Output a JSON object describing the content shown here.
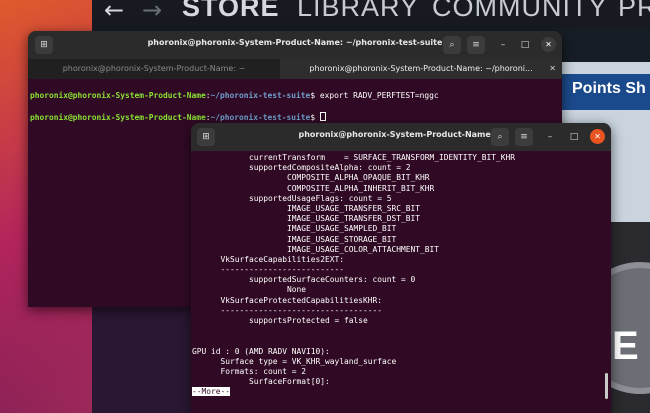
{
  "steam": {
    "nav": [
      "STORE",
      "LIBRARY",
      "COMMUNITY",
      "PR"
    ],
    "points_label": "Points Sh",
    "art_letter": "E"
  },
  "terminal1": {
    "title": "phoronix@phoronix-System-Product-Name: ~/phoronix-test-suite",
    "tabs": [
      {
        "label": "phoronix@phoronix-System-Product-Name: ~"
      },
      {
        "label": "phoronix@phoronix-System-Product-Name: ~/phoroni..."
      }
    ],
    "lines": [
      {
        "user": "phoronix@phoronix-System-Product-Name",
        "path": "~/phoronix-test-suite",
        "cmd": "export RADV_PERFTEST=nggc"
      },
      {
        "user": "phoronix@phoronix-System-Product-Name",
        "path": "~/phoronix-test-suite",
        "cmd": ""
      }
    ]
  },
  "terminal2": {
    "title": "phoronix@phoronix-System-Product-Name: ~",
    "lines": [
      "            currentTransform    = SURFACE_TRANSFORM_IDENTITY_BIT_KHR",
      "            supportedCompositeAlpha: count = 2",
      "                    COMPOSITE_ALPHA_OPAQUE_BIT_KHR",
      "                    COMPOSITE_ALPHA_INHERIT_BIT_KHR",
      "            supportedUsageFlags: count = 5",
      "                    IMAGE_USAGE_TRANSFER_SRC_BIT",
      "                    IMAGE_USAGE_TRANSFER_DST_BIT",
      "                    IMAGE_USAGE_SAMPLED_BIT",
      "                    IMAGE_USAGE_STORAGE_BIT",
      "                    IMAGE_USAGE_COLOR_ATTACHMENT_BIT",
      "      VkSurfaceCapabilities2EXT:",
      "      --------------------------",
      "            supportedSurfaceCounters: count = 0",
      "                    None",
      "      VkSurfaceProtectedCapabilitiesKHR:",
      "      ----------------------------------",
      "            supportsProtected = false",
      "",
      "",
      "GPU id : 0 (AMD RADV NAVI10):",
      "      Surface type = VK_KHR_wayland_surface",
      "      Formats: count = 2",
      "            SurfaceFormat[0]:"
    ],
    "pager": "--More--"
  },
  "colors": {
    "terminal_bg": "#300a24",
    "prompt_user": "#8ae234",
    "prompt_path": "#729fcf",
    "close_button": "#e95420"
  }
}
